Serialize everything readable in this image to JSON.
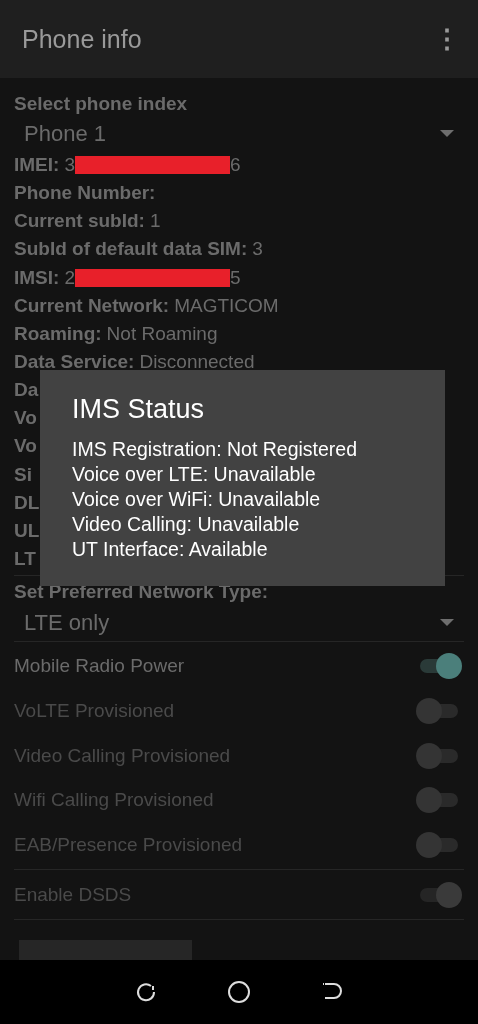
{
  "app_bar": {
    "title": "Phone info",
    "menu_icon": "⋮"
  },
  "phone_index": {
    "label": "Select phone index",
    "value": "Phone 1"
  },
  "info_rows": [
    {
      "label": "IMEI:",
      "value_before": "3",
      "redacted": true,
      "value_after": "6"
    },
    {
      "label": "Phone Number:",
      "value_before": "",
      "redacted": false,
      "value_after": ""
    },
    {
      "label": "Current subId:",
      "value_before": "1",
      "redacted": false,
      "value_after": ""
    },
    {
      "label": "SubId of default data SIM:",
      "value_before": "3",
      "redacted": false,
      "value_after": ""
    },
    {
      "label": "IMSI:",
      "value_before": "2",
      "redacted": true,
      "value_after": "5"
    },
    {
      "label": "Current Network:",
      "value_before": "MAGTICOM",
      "redacted": false,
      "value_after": ""
    },
    {
      "label": "Roaming:",
      "value_before": "Not Roaming",
      "redacted": false,
      "value_after": ""
    },
    {
      "label": "Data Service:",
      "value_before": "Disconnected",
      "redacted": false,
      "value_after": ""
    }
  ],
  "hidden_rows": [
    "Da",
    "Vo",
    "Vo",
    "Si",
    "DL",
    "UL",
    "LT"
  ],
  "network_type": {
    "label": "Set Preferred Network Type:",
    "value": "LTE only"
  },
  "switches": [
    {
      "label": "Mobile Radio Power",
      "on": true,
      "disabled": false,
      "divider": false
    },
    {
      "label": "VoLTE Provisioned",
      "on": false,
      "disabled": true,
      "divider": false
    },
    {
      "label": "Video Calling Provisioned",
      "on": false,
      "disabled": true,
      "divider": false
    },
    {
      "label": "Wifi Calling Provisioned",
      "on": false,
      "disabled": true,
      "divider": false
    },
    {
      "label": "EAB/Presence Provisioned",
      "on": false,
      "disabled": true,
      "divider": true
    },
    {
      "label": "Enable DSDS",
      "on": true,
      "disabled": true,
      "divider": true
    }
  ],
  "dialog": {
    "title": "IMS Status",
    "lines": [
      "IMS Registration: Not Registered",
      "Voice over LTE: Unavailable",
      "Voice over WiFi: Unavailable",
      "Video Calling: Unavailable",
      "UT Interface: Available"
    ]
  }
}
